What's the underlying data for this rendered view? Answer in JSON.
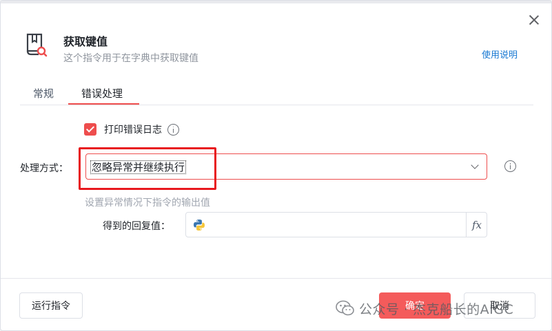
{
  "dialog": {
    "title": "获取键值",
    "subtitle": "这个指令用于在字典中获取键值",
    "help_link": "使用说明",
    "icon": "book-search-icon",
    "close_icon": "close-icon"
  },
  "tabs": [
    {
      "label": "常规",
      "active": false
    },
    {
      "label": "错误处理",
      "active": true
    }
  ],
  "error_handling": {
    "print_log": {
      "label": "打印错误日志",
      "checked": true
    },
    "mode": {
      "label": "处理方式：",
      "value": "忽略异常并继续执行"
    },
    "hint": "设置异常情况下指令的输出值",
    "return_value": {
      "label": "得到的回复值：",
      "value": "",
      "icon": "python-icon",
      "fx_label": "fx"
    }
  },
  "footer": {
    "run_button": "运行指令",
    "ok_button": "确定",
    "cancel_button": "取消"
  },
  "watermark": {
    "text": "公众号 · 杰克船长的AIGC"
  },
  "colors": {
    "accent": "#ee4d4d",
    "primary_button": "#f45b5b",
    "link": "#1677d2",
    "highlight": "#e8181d"
  }
}
